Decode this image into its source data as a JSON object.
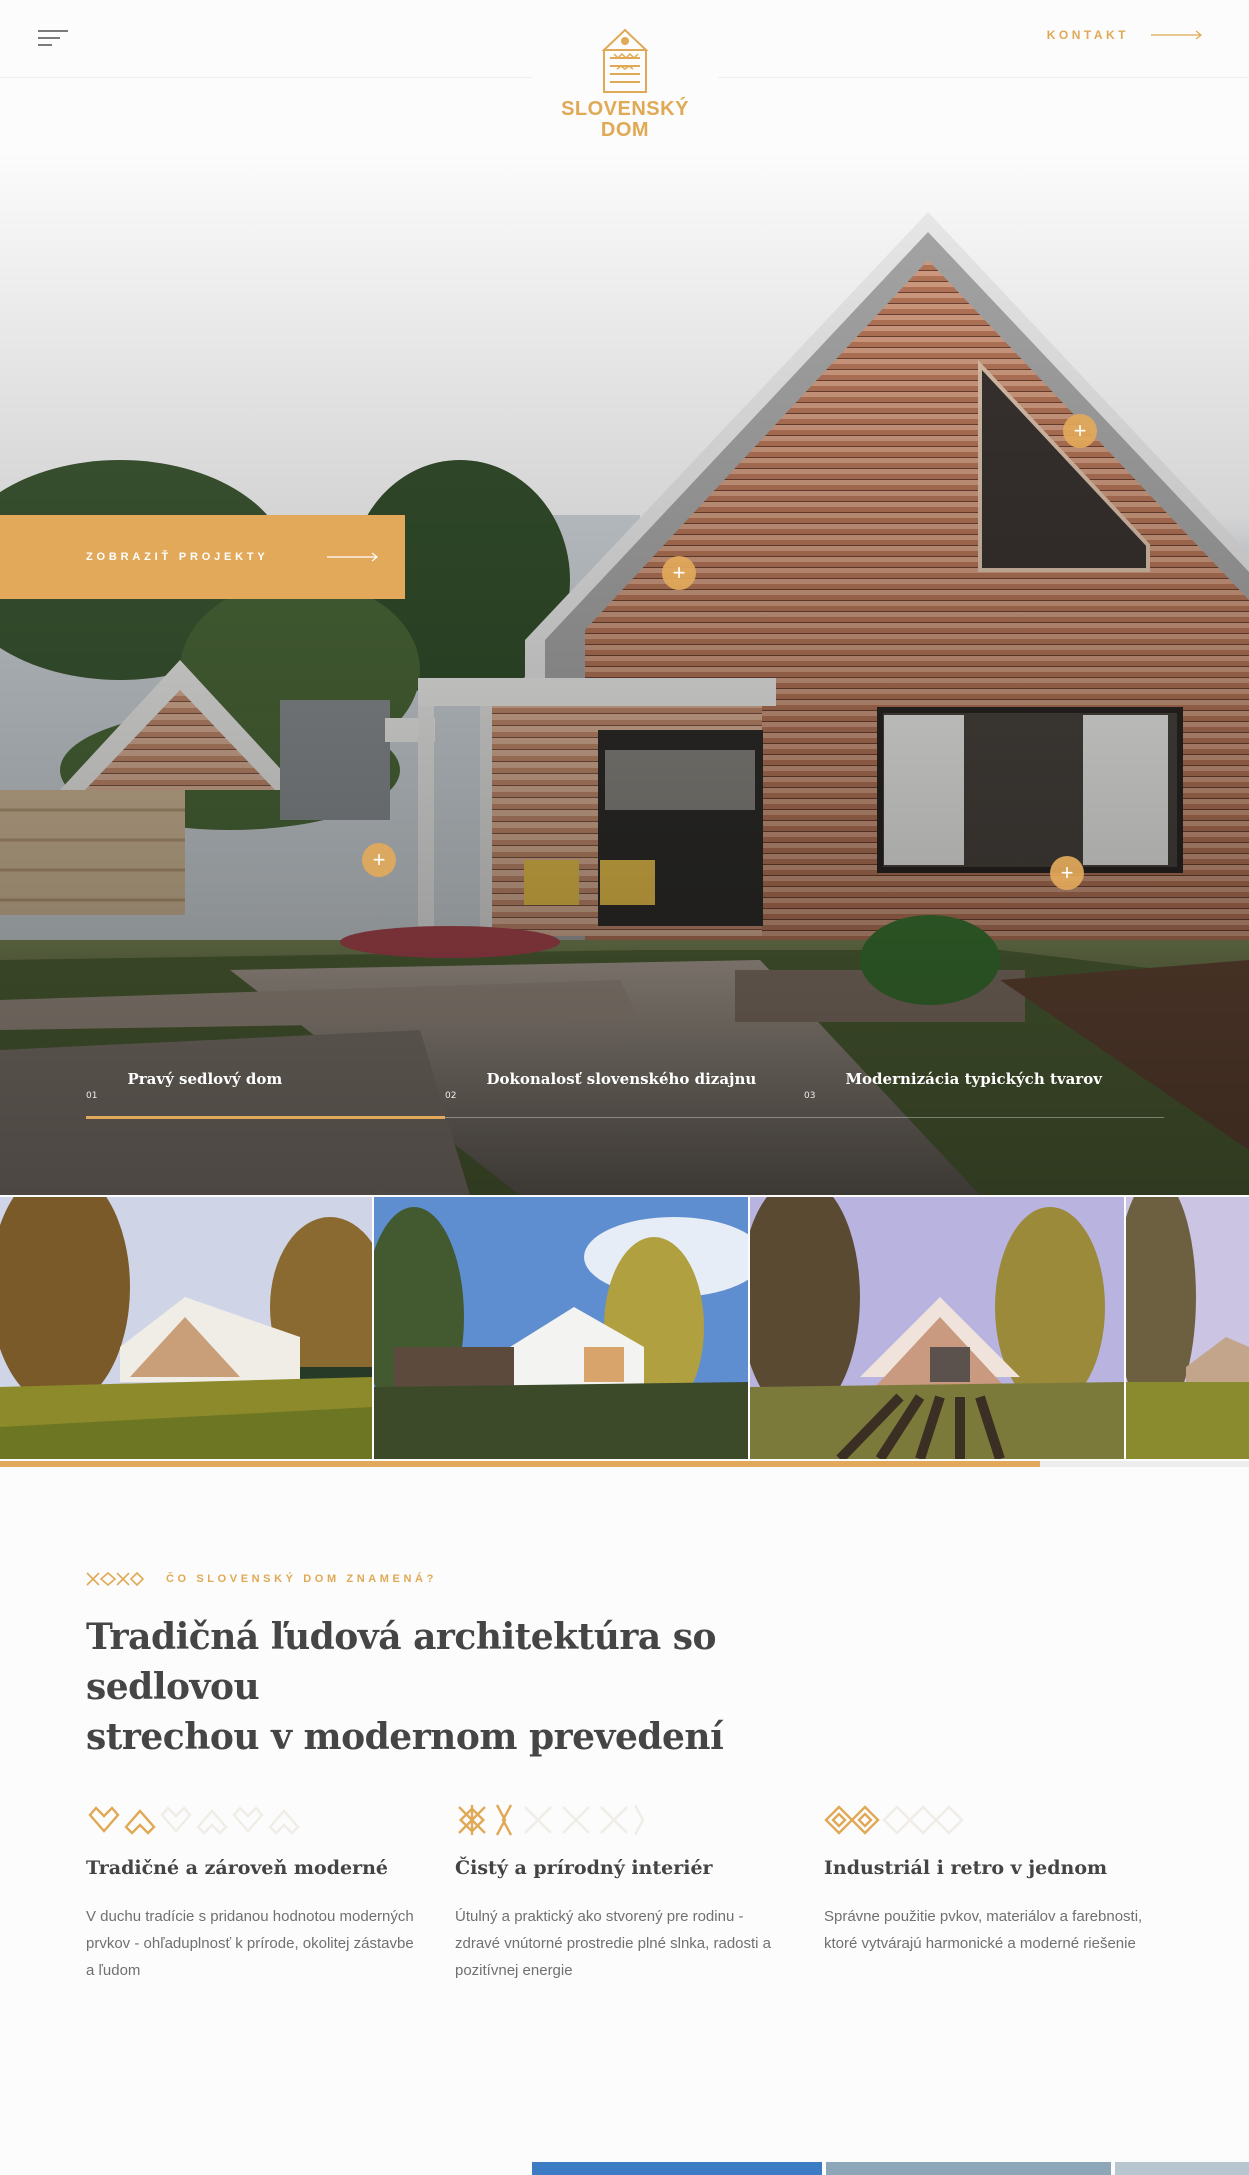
{
  "brand": {
    "name_line1": "SLOVENSKÝ",
    "name_line2": "DOM",
    "color": "#e0a955"
  },
  "header": {
    "menu_icon": "hamburger-icon",
    "contact_label": "KONTAKT",
    "contact_icon": "arrow-right-icon"
  },
  "hero": {
    "cta_label": "ZOBRAZIŤ PROJEKTY",
    "cta_icon": "arrow-right-icon",
    "hotspot_icon": "plus-icon",
    "hotspot_symbol": "+",
    "slides": [
      {
        "num": "01",
        "title": "Pravý sedlový dom"
      },
      {
        "num": "02",
        "title": "Dokonalosť slovenského dizajnu"
      },
      {
        "num": "03",
        "title": "Modernizácia typických tvarov"
      }
    ],
    "active_slide": 1
  },
  "gallery": {
    "thumbnail_count_visible": 4,
    "progress_fraction": 0.833
  },
  "about": {
    "eyebrow_icon": "folk-ornament-icon",
    "eyebrow": "ČO SLOVENSKÝ DOM ZNAMENÁ?",
    "headline_line1": "Tradičná ľudová architektúra so sedlovou",
    "headline_line2": "strechou v modernom prevedení",
    "features": [
      {
        "icon": "heart-ornament-icon",
        "title": "Tradičné a zároveň moderné",
        "desc": "V duchu tradície s pridanou hodnotou moderných prvkov - ohľaduplnosť k prírode, okolitej zástavbe a ľudom"
      },
      {
        "icon": "cross-ornament-icon",
        "title": "Čistý a prírodný interiér",
        "desc": "Útulný a praktický  ako stvorený pre rodinu - zdravé vnútorné prostredie plné slnka, radosti a pozitívnej energie"
      },
      {
        "icon": "diamond-ornament-icon",
        "title": "Industriál i retro v jednom",
        "desc": "Správne použitie pvkov, materiálov a farebnosti, ktoré vytvárajú harmonické a moderné riešenie"
      }
    ]
  },
  "colors": {
    "accent": "#e2a95a",
    "text_dark": "#454545",
    "text_muted": "#707070"
  }
}
